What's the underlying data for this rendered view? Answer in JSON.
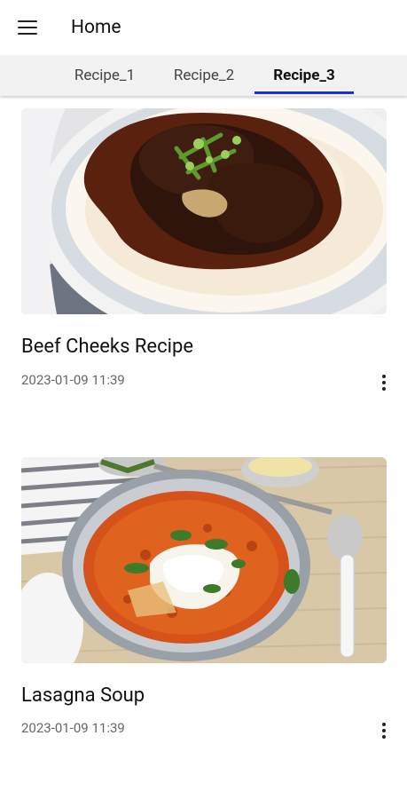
{
  "appbar": {
    "title": "Home",
    "menu_icon": "hamburger-menu-icon"
  },
  "tabs": [
    {
      "label": "Recipe_1",
      "active": false
    },
    {
      "label": "Recipe_2",
      "active": false
    },
    {
      "label": "Recipe_3",
      "active": true
    }
  ],
  "colors": {
    "tab_indicator": "#1e2fd6"
  },
  "recipes": [
    {
      "title": "Beef Cheeks Recipe",
      "timestamp": "2023-01-09 11:39",
      "image": "beef-cheeks-photo"
    },
    {
      "title": "Lasagna Soup",
      "timestamp": "2023-01-09 11:39",
      "image": "lasagna-soup-photo"
    }
  ]
}
